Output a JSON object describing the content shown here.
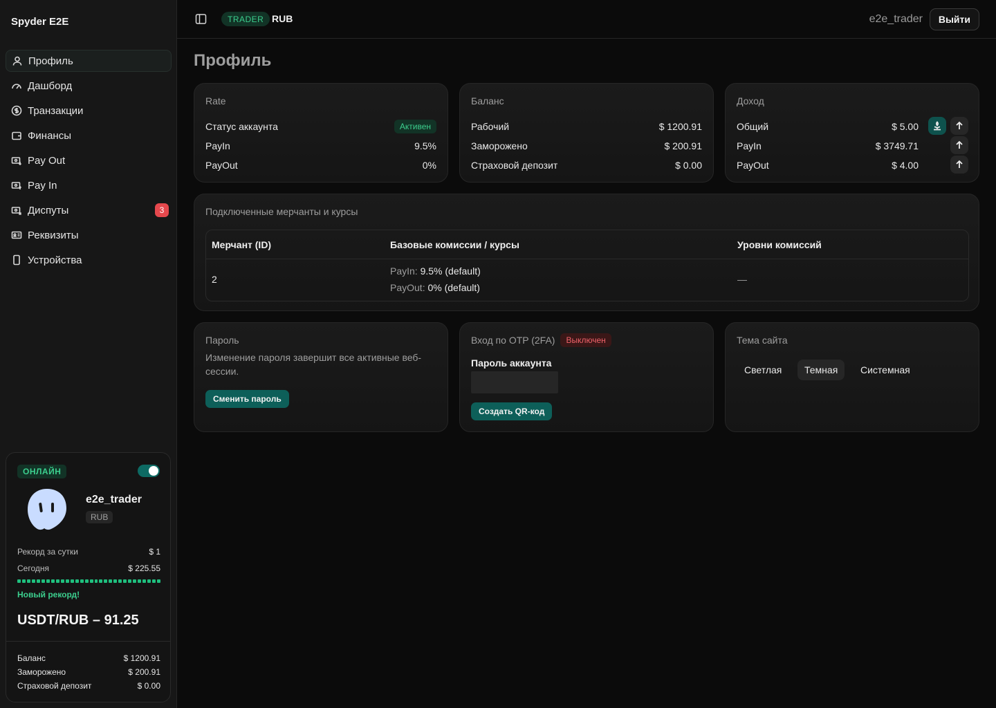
{
  "app": {
    "brand": "Spyder E2E"
  },
  "sidebar": {
    "items": [
      {
        "label": "Профиль",
        "icon": "user-icon"
      },
      {
        "label": "Дашборд",
        "icon": "gauge-icon"
      },
      {
        "label": "Транзакции",
        "icon": "dollar-circle-icon"
      },
      {
        "label": "Финансы",
        "icon": "wallet-icon"
      },
      {
        "label": "Pay Out",
        "icon": "money-out-icon"
      },
      {
        "label": "Pay In",
        "icon": "money-in-icon"
      },
      {
        "label": "Диспуты",
        "icon": "money-x-icon",
        "badge": "3"
      },
      {
        "label": "Реквизиты",
        "icon": "id-card-icon"
      },
      {
        "label": "Устройства",
        "icon": "phone-icon"
      }
    ],
    "card": {
      "status": "ОНЛАЙН",
      "online": true,
      "username": "e2e_trader",
      "currency": "RUB",
      "record_label": "Рекорд за сутки",
      "record_value": "$ 1",
      "today_label": "Сегодня",
      "today_value": "$ 225.55",
      "progress": 1.0,
      "new_record": "Новый рекорд!",
      "rate": "USDT/RUB – 91.25",
      "balance_label": "Баланс",
      "balance_value": "$ 1200.91",
      "frozen_label": "Заморожено",
      "frozen_value": "$ 200.91",
      "deposit_label": "Страховой депозит",
      "deposit_value": "$ 0.00"
    }
  },
  "topbar": {
    "role": "TRADER",
    "currency": "RUB",
    "user": "e2e_trader",
    "logout": "Выйти"
  },
  "page": {
    "title": "Профиль"
  },
  "rate_card": {
    "title": "Rate",
    "status_label": "Статус аккаунта",
    "status_value": "Активен",
    "payin_label": "PayIn",
    "payin_value": "9.5%",
    "payout_label": "PayOut",
    "payout_value": "0%"
  },
  "balance_card": {
    "title": "Баланс",
    "working_label": "Рабочий",
    "working_value": "$ 1200.91",
    "frozen_label": "Заморожено",
    "frozen_value": "$ 200.91",
    "deposit_label": "Страховой депозит",
    "deposit_value": "$ 0.00"
  },
  "income_card": {
    "title": "Доход",
    "total_label": "Общий",
    "total_value": "$ 5.00",
    "payin_label": "PayIn",
    "payin_value": "$ 3749.71",
    "payout_label": "PayOut",
    "payout_value": "$ 4.00"
  },
  "merchants": {
    "title": "Подключенные мерчанты и курсы",
    "headers": [
      "Мерчант (ID)",
      "Базовые комиссии / курсы",
      "Уровни комиссий"
    ],
    "rows": [
      {
        "id": "2",
        "payin_label": "PayIn:",
        "payin_value": "9.5% (default)",
        "payout_label": "PayOut:",
        "payout_value": "0% (default)",
        "levels": "—"
      }
    ]
  },
  "password_card": {
    "title": "Пароль",
    "description": "Изменение пароля завершит все активные веб-сессии.",
    "button": "Сменить пароль"
  },
  "otp_card": {
    "title": "Вход по OTP (2FA)",
    "status": "Выключен",
    "field_label": "Пароль аккаунта",
    "field_value": "",
    "button": "Создать QR-код"
  },
  "theme_card": {
    "title": "Тема сайта",
    "options": [
      "Светлая",
      "Темная",
      "Системная"
    ],
    "selected": "Темная"
  }
}
